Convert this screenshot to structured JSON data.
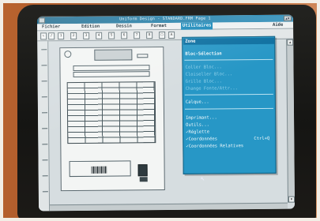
{
  "titlebar": {
    "title": "Uniform Design - STANDARD.FRM Page 1"
  },
  "menubar": {
    "items": [
      "Fichier",
      "Edition",
      "Dessin",
      "Format",
      "Utilitaires"
    ],
    "help": "Aide",
    "active_index": 4
  },
  "ruler": {
    "numbers": [
      "1",
      "2",
      "3",
      "4",
      "5",
      "6",
      "7",
      "8"
    ]
  },
  "dropdown": {
    "items": [
      {
        "label": "Zone",
        "style": "highlight"
      },
      {
        "label": "Bloc-Sélection",
        "style": "bold"
      },
      {
        "label": "Coller Bloc...",
        "style": "dim"
      },
      {
        "label": "Cloiseller Bloc...",
        "style": "dim"
      },
      {
        "label": "Grille Bloc...",
        "style": "dim"
      },
      {
        "label": "Change Fonte/Attr...",
        "style": "dim"
      },
      {
        "label": "Calque...",
        "style": "normal"
      },
      {
        "label": "Imprimant...",
        "style": "normal"
      },
      {
        "label": "Outils...",
        "style": "normal"
      },
      {
        "label": "✓Réglette",
        "style": "normal"
      },
      {
        "label": "✓Coordonnées",
        "style": "normal",
        "shortcut": "Ctrl+Q"
      },
      {
        "label": "✓Coordonnées Relatives",
        "style": "normal"
      }
    ]
  },
  "colors": {
    "accent": "#2797c6",
    "highlight": "#0d6fa0"
  },
  "icons": [
    "cursor-arrow-icon",
    "barcode-icon"
  ]
}
